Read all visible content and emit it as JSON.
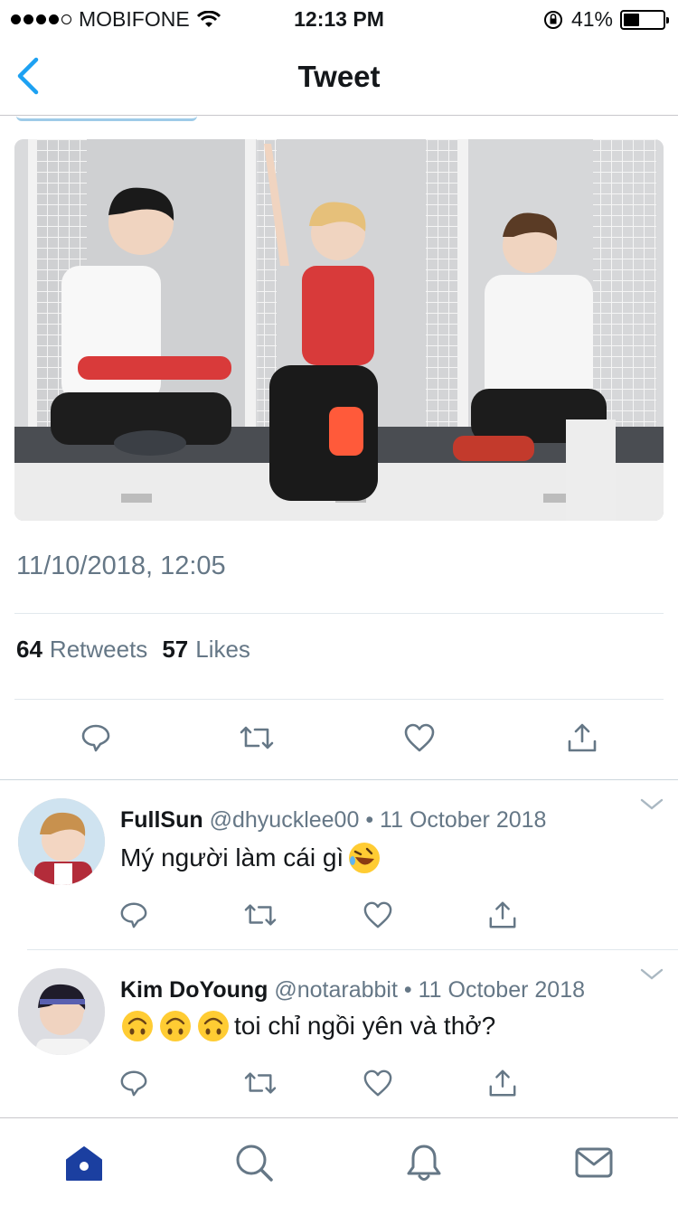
{
  "status_bar": {
    "carrier": "MOBIFONE",
    "time": "12:13 PM",
    "battery_percent_label": "41%",
    "battery_level": 0.41,
    "signal_bars_filled": 4,
    "signal_bars_total": 5
  },
  "nav": {
    "title": "Tweet",
    "back_icon": "chevron-left-icon"
  },
  "tweet": {
    "photo_alt": "",
    "timestamp": "11/10/2018, 12:05",
    "retweets_count": "64",
    "retweets_label": "Retweets",
    "likes_count": "57",
    "likes_label": "Likes",
    "actions": [
      "reply-icon",
      "retweet-icon",
      "like-icon",
      "share-icon"
    ]
  },
  "replies": [
    {
      "name": "FullSun",
      "handle": "@dhyucklee00",
      "separator": "•",
      "date": "11 October 2018",
      "text": "Mý người làm cái gì",
      "emoji": "rolling-laughing-emoji"
    },
    {
      "name": "Kim DoYoung",
      "handle": "@notarabbit",
      "separator": "•",
      "date": "11 October 2018",
      "text": "toi chỉ ngồi yên và thở?",
      "emoji": "upside-down-face-emoji"
    }
  ],
  "tab_bar": [
    "home-icon",
    "search-icon",
    "notifications-icon",
    "messages-icon"
  ],
  "colors": {
    "accent": "#1da1f2",
    "text": "#14171a",
    "muted": "#657786",
    "home_active": "#1b3fa0",
    "tab_icon": "#657786"
  }
}
